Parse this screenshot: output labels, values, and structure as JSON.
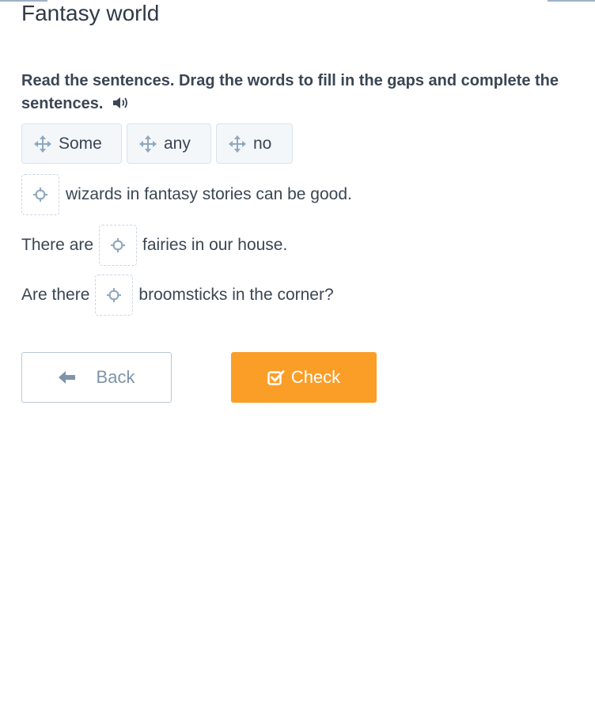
{
  "page": {
    "title": "Fantasy world",
    "instruction": "Read the sentences. Drag the words to fill in the gaps and complete the sentences.",
    "speaker_icon": "speaker-icon"
  },
  "word_bank": {
    "items": [
      {
        "label": "Some",
        "icon": "move-icon"
      },
      {
        "label": "any",
        "icon": "move-icon"
      },
      {
        "label": "no",
        "icon": "move-icon"
      }
    ]
  },
  "sentences": [
    {
      "before": "",
      "after": "wizards in fantasy stories can be good."
    },
    {
      "before": "There are",
      "after": "fairies in our house."
    },
    {
      "before": "Are there",
      "after": "broomsticks in the corner?"
    }
  ],
  "buttons": {
    "back_label": "Back",
    "check_label": "Check"
  },
  "colors": {
    "accent": "#fb9e28",
    "text": "#3b4654",
    "chip_background": "#f3f7fa",
    "icon": "#8fa8bf"
  }
}
